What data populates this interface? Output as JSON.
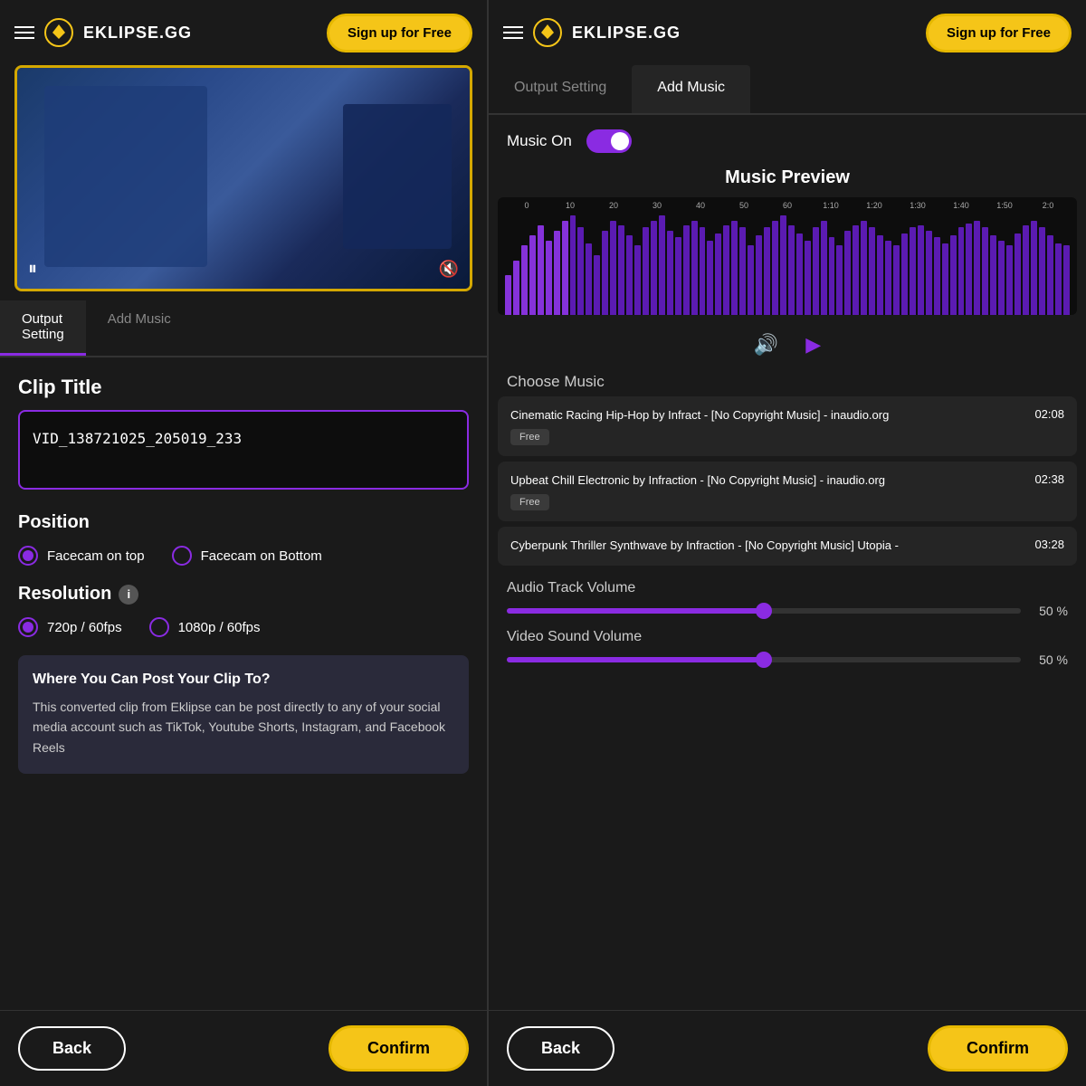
{
  "left_panel": {
    "header": {
      "logo_text": "EKLIPSE.GG",
      "signup_btn": "Sign up for Free"
    },
    "tabs": [
      {
        "label": "Output\nSetting",
        "active": true
      },
      {
        "label": "Add Music",
        "active": false
      }
    ],
    "clip_title_label": "Clip Title",
    "clip_title_value": "VID_138721025_205019_233",
    "position_label": "Position",
    "position_options": [
      {
        "label": "Facecam on top",
        "selected": true
      },
      {
        "label": "Facecam on Bottom",
        "selected": false
      }
    ],
    "resolution_label": "Resolution",
    "resolution_options": [
      {
        "label": "720p / 60fps",
        "selected": true
      },
      {
        "label": "1080p / 60fps",
        "selected": false
      }
    ],
    "info_box": {
      "title": "Where You Can Post Your Clip To?",
      "text": "This converted clip from Eklipse can be post directly to any of your social media account such as TikTok, Youtube Shorts, Instagram, and Facebook Reels"
    },
    "back_btn": "Back",
    "confirm_btn": "Confirm"
  },
  "right_panel": {
    "header": {
      "logo_text": "EKLIPSE.GG",
      "signup_btn": "Sign up for Free"
    },
    "tabs": [
      {
        "label": "Output Setting",
        "active": false
      },
      {
        "label": "Add Music",
        "active": true
      }
    ],
    "music_on_label": "Music On",
    "music_preview_title": "Music Preview",
    "ruler_marks": [
      "0",
      "10",
      "20",
      "30",
      "40",
      "50",
      "60",
      "1:10",
      "1:20",
      "1:30",
      "1:40",
      "1:50",
      "2:0"
    ],
    "choose_music_label": "Choose Music",
    "music_items": [
      {
        "title": "Cinematic Racing Hip-Hop by Infract - [No Copyright Music] - inaudio.org",
        "duration": "02:08",
        "badge": "Free"
      },
      {
        "title": "Upbeat Chill Electronic by Infraction - [No Copyright Music] - inaudio.org",
        "duration": "02:38",
        "badge": "Free"
      },
      {
        "title": "Cyberpunk Thriller Synthwave by Infraction - [No Copyright Music] Utopia -",
        "duration": "03:28",
        "badge": ""
      }
    ],
    "audio_track_label": "Audio Track Volume",
    "audio_track_pct": "50 %",
    "video_sound_label": "Video Sound Volume",
    "video_sound_pct": "50 %",
    "back_btn": "Back",
    "confirm_btn": "Confirm"
  }
}
